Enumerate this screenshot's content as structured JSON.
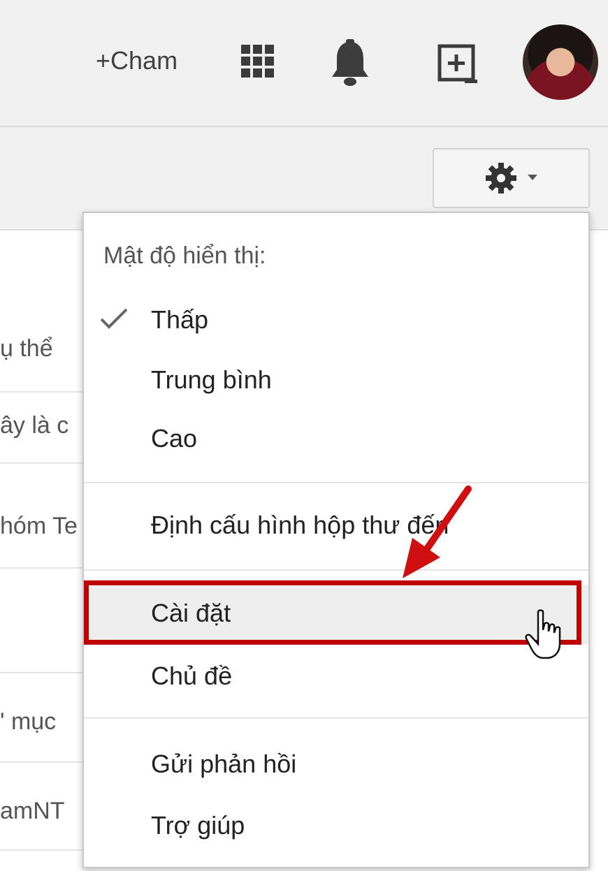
{
  "header": {
    "profile_name": "+Cham",
    "icons": [
      "apps-grid-icon",
      "notifications-bell-icon",
      "share-plus-icon",
      "avatar"
    ]
  },
  "toolbar": {
    "settings_button_icon": "gear-icon",
    "settings_caret_icon": "chevron-down-icon"
  },
  "mail_rows": [
    {
      "text": "ụ thể"
    },
    {
      "text": "ây là c"
    },
    {
      "text": "hóm Te"
    },
    {
      "text": ""
    },
    {
      "text": "' mục"
    },
    {
      "text": "amNT"
    }
  ],
  "menu": {
    "density_header": "Mật độ hiển thị:",
    "density_options": [
      {
        "label": "Thấp",
        "checked": true
      },
      {
        "label": "Trung bình",
        "checked": false
      },
      {
        "label": "Cao",
        "checked": false
      }
    ],
    "configure_inbox": "Định cấu hình hộp thư đến",
    "settings": "Cài đặt",
    "themes": "Chủ đề",
    "send_feedback": "Gửi phản hồi",
    "help": "Trợ giúp"
  },
  "colors": {
    "highlight": "#c00000",
    "arrow": "#d01010",
    "background_bar": "#f1f1f1"
  }
}
